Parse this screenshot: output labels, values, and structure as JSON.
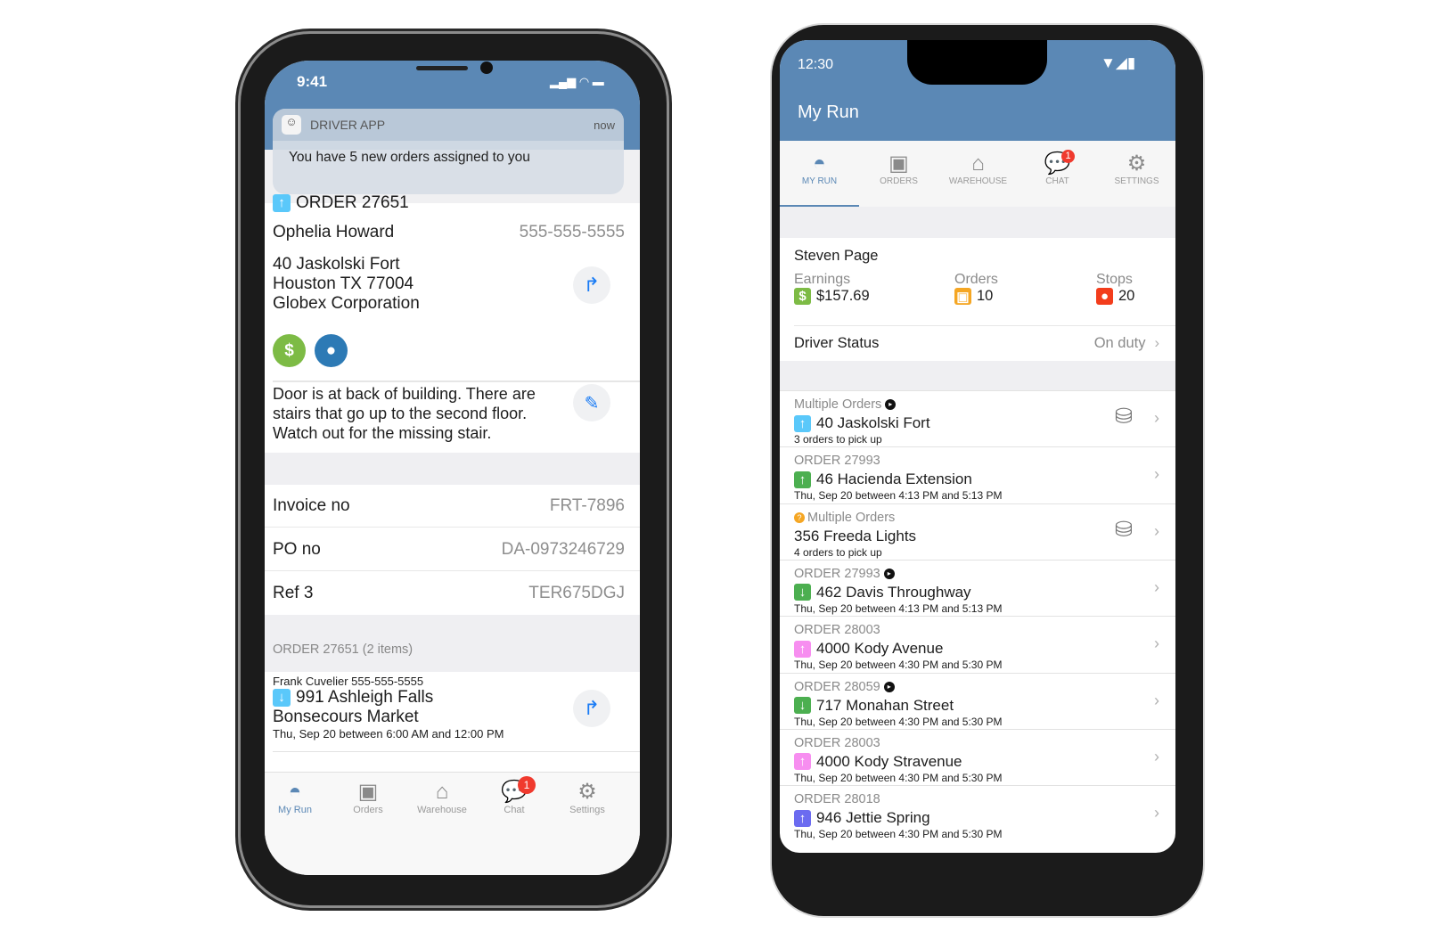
{
  "ios": {
    "status_time": "9:41",
    "notification": {
      "app": "DRIVER APP",
      "time": "now",
      "message": "You have 5 new orders assigned to you"
    },
    "order": {
      "title": "ORDER 27651",
      "customer": "Ophelia Howard",
      "phone": "555-555-5555",
      "address": [
        "40 Jaskolski Fort",
        "Houston TX  77004",
        "Globex Corporation"
      ],
      "notes": [
        "Door is at back of building. There are",
        "stairs that go up to the second floor.",
        "Watch out for the missing stair."
      ]
    },
    "fields": [
      {
        "label": "Invoice no",
        "value": "FRT-7896"
      },
      {
        "label": "PO no",
        "value": "DA-0973246729"
      },
      {
        "label": "Ref 3",
        "value": "TER675DGJ"
      }
    ],
    "items_header": "ORDER 27651 (2 items)",
    "stop": {
      "contact": "Frank Cuvelier 555-555-5555",
      "address": "991 Ashleigh Falls",
      "company": "Bonsecours Market",
      "time": "Thu, Sep 20 between 6:00 AM and 12:00 PM"
    },
    "tabs": [
      {
        "label": "My Run"
      },
      {
        "label": "Orders"
      },
      {
        "label": "Warehouse"
      },
      {
        "label": "Chat",
        "badge": "1"
      },
      {
        "label": "Settings"
      }
    ],
    "active_color": "#5b88b5"
  },
  "android": {
    "status_time": "12:30",
    "title": "My Run",
    "tabs": [
      {
        "label": "MY RUN"
      },
      {
        "label": "ORDERS"
      },
      {
        "label": "WAREHOUSE"
      },
      {
        "label": "CHAT",
        "badge": "1"
      },
      {
        "label": "SETTINGS"
      }
    ],
    "driver": {
      "name": "Steven Page",
      "earnings_label": "Earnings",
      "earnings": "$157.69",
      "orders_label": "Orders",
      "orders": "10",
      "stops_label": "Stops",
      "stops": "20",
      "status_label": "Driver Status",
      "status": "On duty"
    },
    "list": [
      {
        "header": "Multiple Orders",
        "flag": true,
        "arrow": "up",
        "color": "#5ac8fa",
        "address": "40 Jaskolski Fort",
        "sub": "3 orders to pick up",
        "multi": true
      },
      {
        "header": "ORDER 27993",
        "arrow": "up",
        "color": "#4caf50",
        "address": "46 Hacienda Extension",
        "sub": "Thu, Sep 20 between 4:13 PM and 5:13 PM"
      },
      {
        "header": "Multiple Orders",
        "warn": true,
        "address": "356 Freeda Lights",
        "sub": "4 orders to pick up",
        "multi": true
      },
      {
        "header": "ORDER 27993",
        "flag": true,
        "arrow": "down",
        "color": "#4caf50",
        "address": "462 Davis Throughway",
        "sub": "Thu, Sep 20 between 4:13 PM and 5:13 PM"
      },
      {
        "header": "ORDER 28003",
        "arrow": "up",
        "color": "#f78ef0",
        "address": "4000 Kody Avenue",
        "sub": "Thu, Sep 20 between 4:30 PM and 5:30 PM"
      },
      {
        "header": "ORDER 28059",
        "flag": true,
        "arrow": "down",
        "color": "#4caf50",
        "address": "717 Monahan Street",
        "sub": "Thu, Sep 20 between 4:30 PM and 5:30 PM"
      },
      {
        "header": "ORDER 28003",
        "arrow": "up",
        "color": "#f78ef0",
        "address": "4000 Kody Stravenue",
        "sub": "Thu, Sep 20 between 4:30 PM and 5:30 PM"
      },
      {
        "header": "ORDER 28018",
        "arrow": "up",
        "color": "#6b6bf0",
        "address": "946 Jettie Spring",
        "sub": "Thu, Sep 20 between 4:30 PM and 5:30 PM"
      }
    ]
  }
}
